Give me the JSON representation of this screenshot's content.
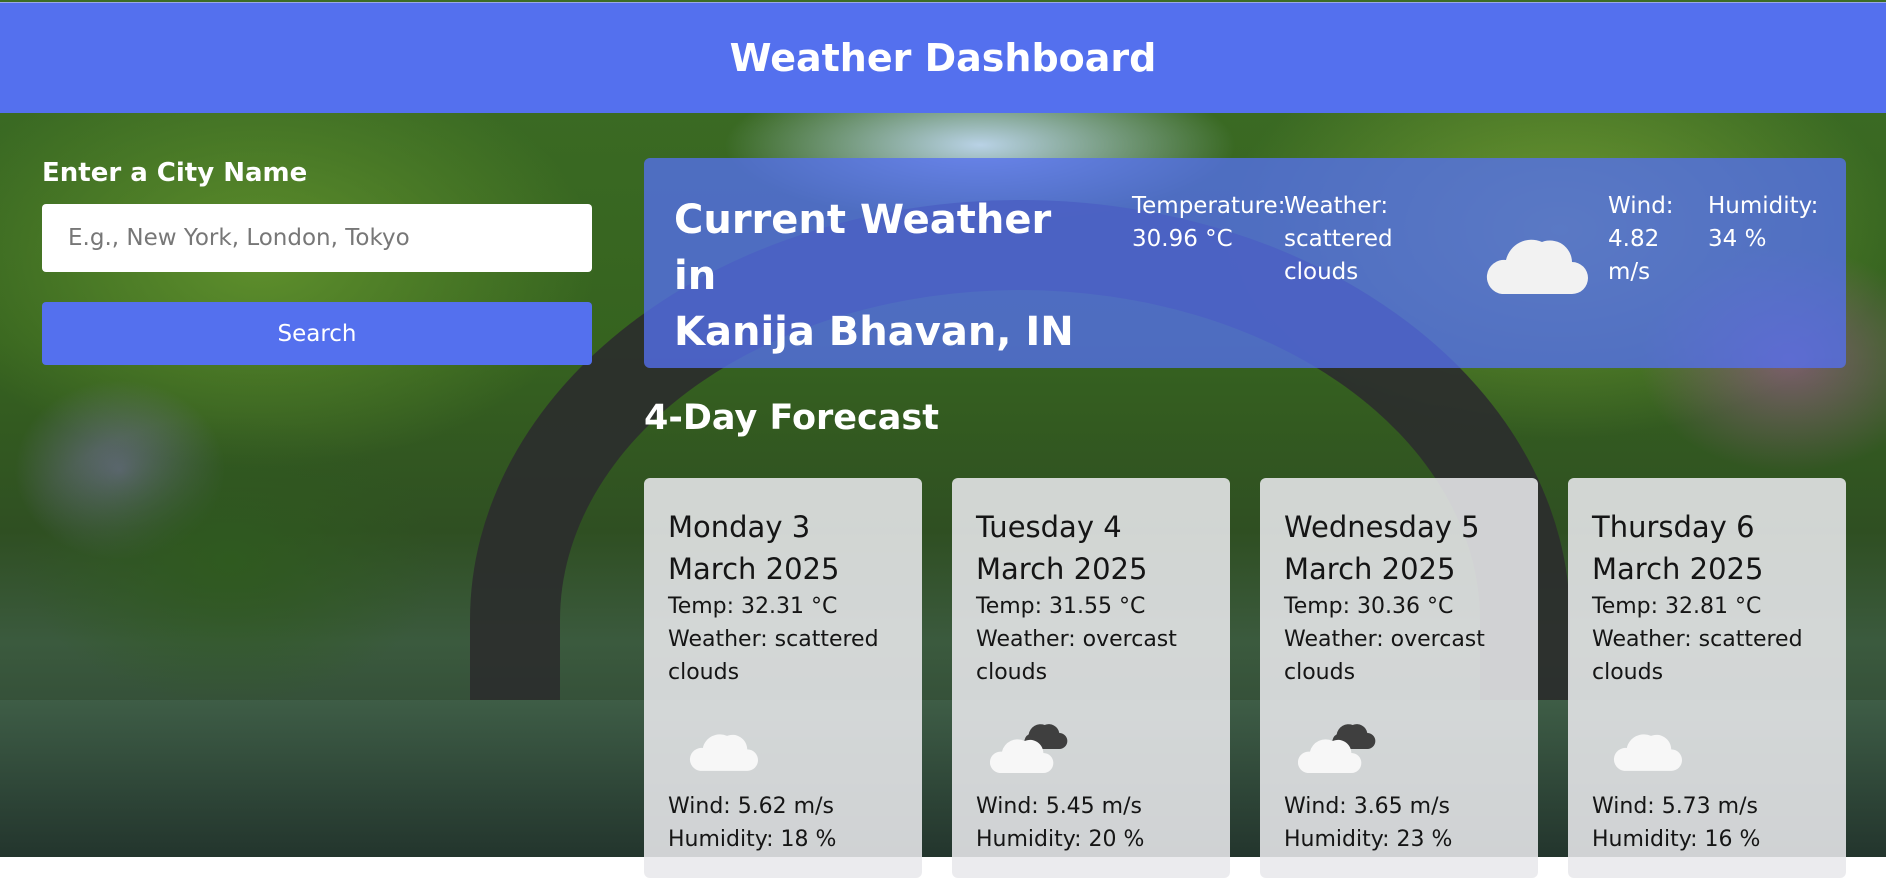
{
  "header": {
    "title": "Weather Dashboard"
  },
  "search": {
    "label": "Enter a City Name",
    "placeholder": "E.g., New York, London, Tokyo",
    "value": "",
    "button_label": "Search"
  },
  "current": {
    "title_line1": "Current Weather in",
    "title_line2": "Kanija Bhavan, IN",
    "temperature_label": "Temperature:",
    "temperature_value": "30.96 °C",
    "weather_label": "Weather:",
    "weather_value": "scattered clouds",
    "wind_label": "Wind:",
    "wind_value": "4.82 m/s",
    "humidity_label": "Humidity:",
    "humidity_value": "34 %",
    "icon": "cloud-icon"
  },
  "forecast": {
    "heading": "4-Day Forecast",
    "days": [
      {
        "date": "Monday 3 March 2025",
        "temp": "Temp: 32.31 °C",
        "weather": "Weather: scattered clouds",
        "icon": "cloud-icon",
        "wind": "Wind: 5.62 m/s",
        "humidity": "Humidity: 18 %"
      },
      {
        "date": "Tuesday 4 March 2025",
        "temp": "Temp: 31.55 °C",
        "weather": "Weather: overcast clouds",
        "icon": "overcast-clouds-icon",
        "wind": "Wind: 5.45 m/s",
        "humidity": "Humidity: 20 %"
      },
      {
        "date": "Wednesday 5 March 2025",
        "temp": "Temp: 30.36 °C",
        "weather": "Weather: overcast clouds",
        "icon": "overcast-clouds-icon",
        "wind": "Wind: 3.65 m/s",
        "humidity": "Humidity: 23 %"
      },
      {
        "date": "Thursday 6 March 2025",
        "temp": "Temp: 32.81 °C",
        "weather": "Weather: scattered clouds",
        "icon": "cloud-icon",
        "wind": "Wind: 5.73 m/s",
        "humidity": "Humidity: 16 %"
      }
    ]
  },
  "colors": {
    "accent": "#5470ee",
    "card_overlay": "#5570ee",
    "forecast_card": "#e8e8ec"
  }
}
